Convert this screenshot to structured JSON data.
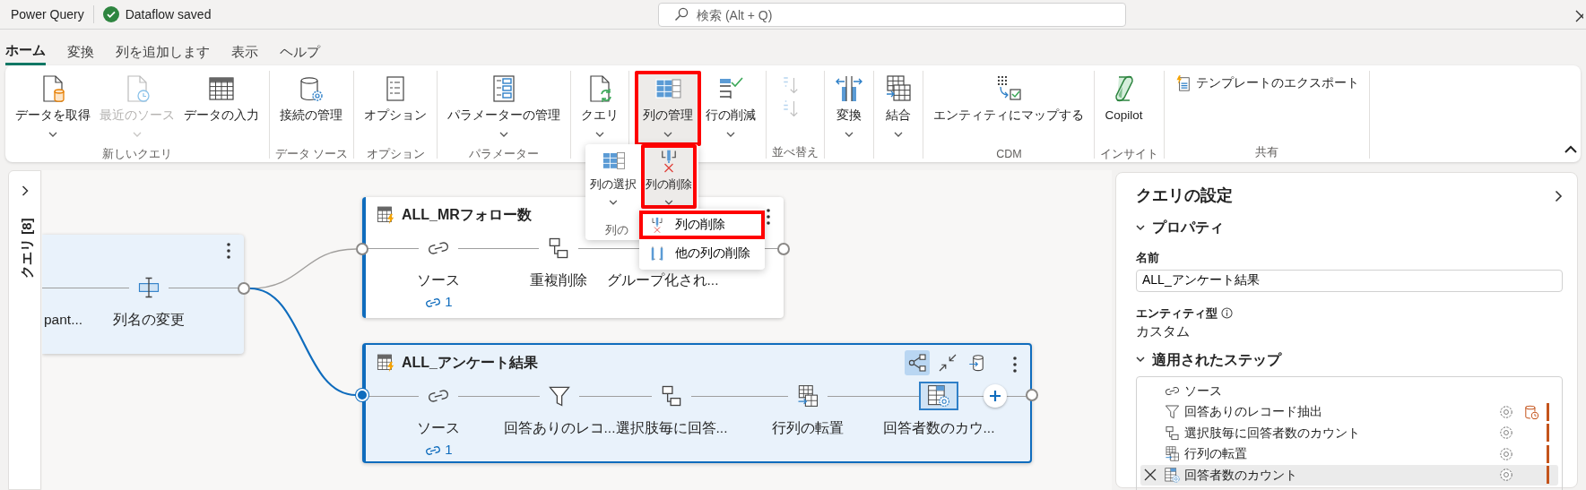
{
  "app": {
    "title": "Power Query",
    "status": "Dataflow saved"
  },
  "search": {
    "placeholder": "検索 (Alt + Q)"
  },
  "tabs": [
    {
      "label": "ホーム",
      "selected": true
    },
    {
      "label": "変換",
      "selected": false
    },
    {
      "label": "列を追加します",
      "selected": false
    },
    {
      "label": "表示",
      "selected": false
    },
    {
      "label": "ヘルプ",
      "selected": false
    }
  ],
  "ribbon": {
    "groups": [
      {
        "label": "新しいクエリ",
        "buttons": [
          {
            "label": "データを取得",
            "kind": "getdata",
            "dropdown": true,
            "disabled": false,
            "highlighted": false
          },
          {
            "label": "最近のソース",
            "kind": "recent",
            "dropdown": true,
            "disabled": true,
            "highlighted": false
          },
          {
            "label": "データの入力",
            "kind": "enter",
            "dropdown": false,
            "disabled": false,
            "highlighted": false
          }
        ]
      },
      {
        "label": "データ ソース",
        "buttons": [
          {
            "label": "接続の管理",
            "kind": "connections",
            "dropdown": false,
            "disabled": false,
            "highlighted": false
          }
        ]
      },
      {
        "label": "オプション",
        "buttons": [
          {
            "label": "オプション",
            "kind": "options",
            "dropdown": false,
            "disabled": false,
            "highlighted": false
          }
        ]
      },
      {
        "label": "パラメーター",
        "buttons": [
          {
            "label": "パラメーターの管理",
            "kind": "parameters",
            "dropdown": true,
            "disabled": false,
            "highlighted": false
          }
        ]
      },
      {
        "buttons": [
          {
            "label": "クエリ",
            "kind": "queries",
            "dropdown": true,
            "disabled": false,
            "highlighted": false
          }
        ]
      },
      {
        "buttons": [
          {
            "label": "列の管理",
            "kind": "columns",
            "dropdown": true,
            "disabled": false,
            "highlighted": true
          },
          {
            "label": "行の削減",
            "kind": "reduce",
            "dropdown": true,
            "disabled": false,
            "highlighted": false
          }
        ]
      },
      {
        "label": "並べ替え",
        "buttons": [
          {
            "kind": "sortasc",
            "dropdown": false,
            "disabled": true,
            "highlighted": false
          },
          {
            "kind": "sortdesc",
            "dropdown": false,
            "disabled": true,
            "highlighted": false
          }
        ]
      },
      {
        "buttons": [
          {
            "label": "変換",
            "kind": "transform",
            "dropdown": true,
            "disabled": false,
            "highlighted": false
          }
        ]
      },
      {
        "buttons": [
          {
            "label": "結合",
            "kind": "combine",
            "dropdown": true,
            "disabled": false,
            "highlighted": false
          }
        ]
      },
      {
        "label": "CDM",
        "buttons": [
          {
            "label": "エンティティにマップする",
            "kind": "cdm",
            "dropdown": false,
            "disabled": false,
            "highlighted": false
          }
        ]
      },
      {
        "label": "インサイト",
        "buttons": [
          {
            "label": "Copilot",
            "kind": "copilot",
            "dropdown": false,
            "disabled": false,
            "highlighted": false
          }
        ]
      },
      {
        "label": "共有",
        "buttons": [
          {
            "label": "テンプレートのエクスポート",
            "kind": "template",
            "dropdown": false,
            "disabled": false,
            "highlighted": false
          }
        ]
      }
    ]
  },
  "column_menu": {
    "group_label": "列の",
    "buttons": [
      {
        "label": "列の選択",
        "kind": "choose",
        "dropdown": true,
        "pressed": false,
        "highlighted": false
      },
      {
        "label": "列の削除",
        "kind": "remove",
        "dropdown": true,
        "pressed": true,
        "highlighted": true
      }
    ]
  },
  "remove_menu": {
    "items": [
      {
        "label": "列の削除",
        "kind": "remove",
        "highlighted": true
      },
      {
        "label": "他の列の削除",
        "kind": "removeother",
        "highlighted": false
      }
    ]
  },
  "queries_pane": {
    "label": "クエリ [8]"
  },
  "diagram": {
    "queries": [
      {
        "selected": false,
        "related": true,
        "steps": [
          {
            "label": "pant...",
            "kind": "cut",
            "selected": false
          },
          {
            "label": "列名の変更",
            "kind": "rename",
            "selected": false
          }
        ]
      },
      {
        "title": "ALL_MRフォロー数",
        "selected": false,
        "related": false,
        "input": {
          "selected": false
        },
        "steps": [
          {
            "label": "ソース",
            "kind": "source",
            "links": "1",
            "selected": false
          },
          {
            "label": "重複削除",
            "kind": "group",
            "selected": false
          },
          {
            "label": "グループ化され...",
            "kind": "covered",
            "selected": false
          }
        ]
      },
      {
        "title": "ALL_アンケート結果",
        "selected": true,
        "related": true,
        "input": {
          "selected": true
        },
        "toolbar": [
          {
            "kind": "diagram",
            "selected": true
          },
          {
            "kind": "collapse",
            "selected": false
          },
          {
            "kind": "export",
            "selected": false
          }
        ],
        "add_step": true,
        "steps": [
          {
            "label": "ソース",
            "kind": "source",
            "links": "1",
            "selected": false
          },
          {
            "label": "回答ありのレコ...",
            "kind": "filter",
            "selected": false
          },
          {
            "label": "選択肢毎に回答...",
            "kind": "group",
            "selected": false
          },
          {
            "label": "行列の転置",
            "kind": "transpose",
            "selected": false
          },
          {
            "label": "回答者数のカウ...",
            "kind": "count",
            "selected": true
          }
        ]
      }
    ]
  },
  "settings": {
    "title": "クエリの設定",
    "properties_heading": "プロパティ",
    "name_label": "名前",
    "name_value": "ALL_アンケート結果",
    "entity_label": "エンティティ型",
    "entity_value": "カスタム",
    "steps_heading": "適用されたステップ",
    "steps": [
      {
        "label": "ソース",
        "kind": "source",
        "selected": false,
        "settings": false,
        "warning": false,
        "modified": false
      },
      {
        "label": "回答ありのレコード抽出",
        "kind": "filter",
        "selected": false,
        "settings": true,
        "warning": true,
        "modified": true
      },
      {
        "label": "選択肢毎に回答者数のカウント",
        "kind": "group",
        "selected": false,
        "settings": true,
        "warning": false,
        "modified": true
      },
      {
        "label": "行列の転置",
        "kind": "transpose",
        "selected": false,
        "settings": true,
        "warning": false,
        "modified": true
      },
      {
        "label": "回答者数のカウント",
        "kind": "count",
        "selected": true,
        "settings": true,
        "warning": false,
        "modified": true
      }
    ]
  }
}
